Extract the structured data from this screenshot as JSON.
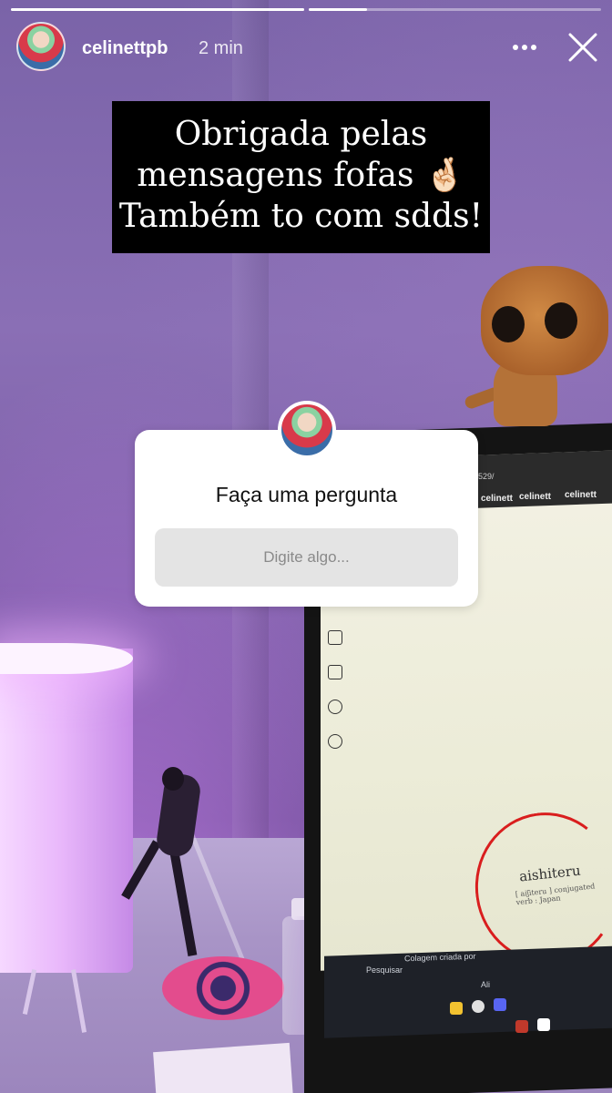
{
  "story": {
    "username": "celinettpb",
    "time": "2 min",
    "progress": [
      1.0,
      0.2
    ],
    "caption_lines": [
      "Obrigada pelas",
      "mensagens fofas 🤞🏻",
      "Também to com sdds!"
    ]
  },
  "question_sticker": {
    "title": "Faça uma pergunta",
    "placeholder": "Digite algo..."
  },
  "photo": {
    "screen_tabs": [
      "celinett",
      "celinett",
      "celinett"
    ],
    "url_fragment": "3529/",
    "word": "aishiteru",
    "word_sub": "[ aiʃiteru ] conjugated verb : Japan",
    "collage_text": "Colagem criada por",
    "collage_name": "Ali",
    "search_text": "Pesquisar"
  },
  "icons": [
    "more-options-icon",
    "close-icon"
  ],
  "colors": {
    "caption_bg": "#000000",
    "sticker_bg": "#ffffff",
    "input_bg": "#e4e4e4",
    "circle": "#d91e1e"
  }
}
